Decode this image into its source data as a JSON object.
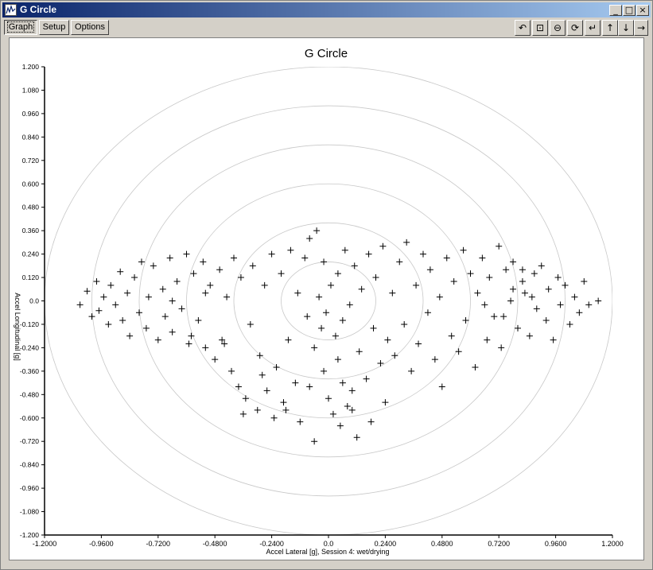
{
  "window": {
    "title": "G Circle"
  },
  "tabs": [
    "Graph",
    "Setup",
    "Options"
  ],
  "toolbar": {
    "icons": [
      "zoom-back-icon",
      "zoom-box-icon",
      "zoom-out-icon",
      "zoom-reset-icon",
      "pan-left-icon",
      "pan-up-icon",
      "pan-down-icon",
      "pan-right-icon"
    ]
  },
  "chart_data": {
    "type": "scatter",
    "title": "G Circle",
    "xlabel": "Accel Lateral [g], Session 4: wet/drying",
    "ylabel": "Accel Longitudinal [g]",
    "xlim": [
      -1.2,
      1.2
    ],
    "ylim": [
      -1.2,
      1.2
    ],
    "xticks": [
      "-1.2000",
      "-0.9600",
      "-0.7200",
      "-0.4800",
      "-0.2400",
      "0.0",
      "0.2400",
      "0.4800",
      "0.7200",
      "0.9600",
      "1.2000"
    ],
    "yticks": [
      "1.200",
      "1.080",
      "0.960",
      "0.840",
      "0.720",
      "0.600",
      "0.480",
      "0.360",
      "0.240",
      "0.120",
      "0.0",
      "-0.120",
      "-0.240",
      "-0.360",
      "-0.480",
      "-0.600",
      "-0.720",
      "-0.840",
      "-0.960",
      "-1.080",
      "-1.200"
    ],
    "reference_circles_g": [
      0.2,
      0.4,
      0.6,
      0.8,
      1.0,
      1.2
    ],
    "marker": "+",
    "marker_color": "#000000",
    "circle_color": "#c8c8c8",
    "points": [
      [
        -1.05,
        -0.02
      ],
      [
        -1.02,
        0.05
      ],
      [
        -1.0,
        -0.08
      ],
      [
        -0.98,
        0.1
      ],
      [
        -0.97,
        -0.05
      ],
      [
        -0.95,
        0.02
      ],
      [
        -0.93,
        -0.12
      ],
      [
        -0.92,
        0.08
      ],
      [
        -0.9,
        -0.02
      ],
      [
        -0.88,
        0.15
      ],
      [
        -0.87,
        -0.1
      ],
      [
        -0.85,
        0.04
      ],
      [
        -0.84,
        -0.18
      ],
      [
        -0.82,
        0.12
      ],
      [
        -0.8,
        -0.06
      ],
      [
        -0.79,
        0.2
      ],
      [
        -0.77,
        -0.14
      ],
      [
        -0.76,
        0.02
      ],
      [
        -0.74,
        0.18
      ],
      [
        -0.72,
        -0.2
      ],
      [
        -0.7,
        0.06
      ],
      [
        -0.69,
        -0.08
      ],
      [
        -0.67,
        0.22
      ],
      [
        -0.66,
        -0.16
      ],
      [
        -0.64,
        0.1
      ],
      [
        -0.62,
        -0.04
      ],
      [
        -0.6,
        0.24
      ],
      [
        -0.59,
        -0.22
      ],
      [
        -0.57,
        0.14
      ],
      [
        -0.55,
        -0.1
      ],
      [
        -0.53,
        0.2
      ],
      [
        -0.52,
        -0.24
      ],
      [
        -0.5,
        0.08
      ],
      [
        -0.48,
        -0.3
      ],
      [
        -0.46,
        0.16
      ],
      [
        -0.45,
        -0.2
      ],
      [
        -0.43,
        0.02
      ],
      [
        -0.41,
        -0.36
      ],
      [
        -0.4,
        0.22
      ],
      [
        -0.38,
        -0.44
      ],
      [
        -0.37,
        0.12
      ],
      [
        -0.35,
        -0.5
      ],
      [
        -0.33,
        -0.12
      ],
      [
        -0.32,
        0.18
      ],
      [
        -0.3,
        -0.56
      ],
      [
        -0.29,
        -0.28
      ],
      [
        -0.27,
        0.08
      ],
      [
        -0.26,
        -0.46
      ],
      [
        -0.24,
        0.24
      ],
      [
        -0.23,
        -0.6
      ],
      [
        -0.22,
        -0.34
      ],
      [
        -0.2,
        0.14
      ],
      [
        -0.19,
        -0.52
      ],
      [
        -0.17,
        -0.2
      ],
      [
        -0.16,
        0.26
      ],
      [
        -0.14,
        -0.42
      ],
      [
        -0.13,
        0.04
      ],
      [
        -0.12,
        -0.62
      ],
      [
        -0.1,
        0.22
      ],
      [
        -0.09,
        -0.08
      ],
      [
        -0.08,
        0.32
      ],
      [
        -0.06,
        -0.24
      ],
      [
        -0.05,
        0.36
      ],
      [
        -0.04,
        0.02
      ],
      [
        -0.03,
        -0.14
      ],
      [
        -0.02,
        0.2
      ],
      [
        -0.01,
        -0.06
      ],
      [
        0.0,
        -0.5
      ],
      [
        0.01,
        0.08
      ],
      [
        0.02,
        -0.58
      ],
      [
        0.03,
        -0.18
      ],
      [
        0.04,
        0.14
      ],
      [
        0.05,
        -0.64
      ],
      [
        0.06,
        -0.1
      ],
      [
        0.07,
        0.26
      ],
      [
        0.08,
        -0.54
      ],
      [
        0.09,
        -0.02
      ],
      [
        0.1,
        -0.46
      ],
      [
        0.11,
        0.18
      ],
      [
        0.12,
        -0.7
      ],
      [
        0.13,
        -0.26
      ],
      [
        0.14,
        0.06
      ],
      [
        0.16,
        -0.4
      ],
      [
        0.17,
        0.24
      ],
      [
        0.19,
        -0.14
      ],
      [
        0.2,
        0.12
      ],
      [
        0.22,
        -0.32
      ],
      [
        0.23,
        0.28
      ],
      [
        0.25,
        -0.2
      ],
      [
        0.27,
        0.04
      ],
      [
        0.28,
        -0.28
      ],
      [
        0.3,
        0.2
      ],
      [
        0.32,
        -0.12
      ],
      [
        0.33,
        0.3
      ],
      [
        0.35,
        -0.36
      ],
      [
        0.37,
        0.08
      ],
      [
        0.38,
        -0.22
      ],
      [
        0.4,
        0.24
      ],
      [
        0.42,
        -0.06
      ],
      [
        0.43,
        0.16
      ],
      [
        0.45,
        -0.3
      ],
      [
        0.47,
        0.02
      ],
      [
        0.48,
        -0.44
      ],
      [
        0.5,
        0.22
      ],
      [
        0.52,
        -0.18
      ],
      [
        0.53,
        0.1
      ],
      [
        0.55,
        -0.26
      ],
      [
        0.57,
        0.26
      ],
      [
        0.58,
        -0.1
      ],
      [
        0.6,
        0.14
      ],
      [
        0.62,
        -0.34
      ],
      [
        0.63,
        0.04
      ],
      [
        0.65,
        0.22
      ],
      [
        0.67,
        -0.2
      ],
      [
        0.68,
        0.12
      ],
      [
        0.7,
        -0.08
      ],
      [
        0.72,
        0.28
      ],
      [
        0.73,
        -0.24
      ],
      [
        0.75,
        0.16
      ],
      [
        0.77,
        0.0
      ],
      [
        0.78,
        0.2
      ],
      [
        0.8,
        -0.14
      ],
      [
        0.82,
        0.1
      ],
      [
        0.83,
        0.04
      ],
      [
        0.85,
        -0.18
      ],
      [
        0.87,
        0.14
      ],
      [
        0.88,
        -0.04
      ],
      [
        0.9,
        0.18
      ],
      [
        0.92,
        -0.1
      ],
      [
        0.93,
        0.06
      ],
      [
        0.95,
        -0.2
      ],
      [
        0.97,
        0.12
      ],
      [
        0.98,
        -0.02
      ],
      [
        1.0,
        0.08
      ],
      [
        1.02,
        -0.12
      ],
      [
        1.04,
        0.02
      ],
      [
        1.06,
        -0.06
      ],
      [
        1.08,
        0.1
      ],
      [
        1.1,
        -0.02
      ],
      [
        1.14,
        0.0
      ],
      [
        -0.36,
        -0.58
      ],
      [
        -0.44,
        -0.22
      ],
      [
        -0.58,
        -0.18
      ],
      [
        -0.66,
        0.0
      ],
      [
        -0.52,
        0.04
      ],
      [
        -0.28,
        -0.38
      ],
      [
        -0.18,
        -0.56
      ],
      [
        0.18,
        -0.62
      ],
      [
        0.24,
        -0.52
      ],
      [
        -0.06,
        -0.72
      ],
      [
        0.04,
        -0.3
      ],
      [
        -0.02,
        -0.36
      ],
      [
        0.06,
        -0.42
      ],
      [
        0.1,
        -0.56
      ],
      [
        -0.08,
        -0.44
      ],
      [
        0.78,
        0.06
      ],
      [
        0.82,
        0.16
      ],
      [
        0.86,
        0.02
      ],
      [
        0.74,
        -0.08
      ],
      [
        0.66,
        -0.02
      ]
    ]
  }
}
